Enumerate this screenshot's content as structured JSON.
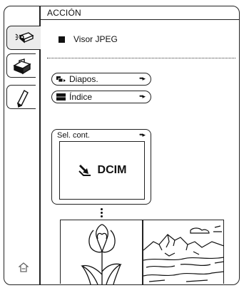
{
  "header": {
    "title": "ACCIÓN"
  },
  "sidebar": {
    "tabs": [
      {
        "icon": "projector-icon",
        "active": true
      },
      {
        "icon": "toolbox-icon",
        "active": false
      },
      {
        "icon": "pen-icon",
        "active": false
      }
    ],
    "home_icon": "home-icon"
  },
  "viewer": {
    "label": "Visor JPEG"
  },
  "buttons": {
    "slideshow": {
      "label": "Diapos.",
      "arrow": "••▸",
      "icon": "slideshow-icon"
    },
    "index": {
      "label": "Índice",
      "arrow": "••▸",
      "icon": "index-icon"
    }
  },
  "folder_select": {
    "label": "Sel. cont.",
    "arrow": "••▸",
    "folder_name": "DCIM",
    "folder_icon": "folder-arrow-icon"
  },
  "thumbnails": [
    {
      "name": "tulip-thumbnail"
    },
    {
      "name": "landscape-thumbnail"
    }
  ]
}
